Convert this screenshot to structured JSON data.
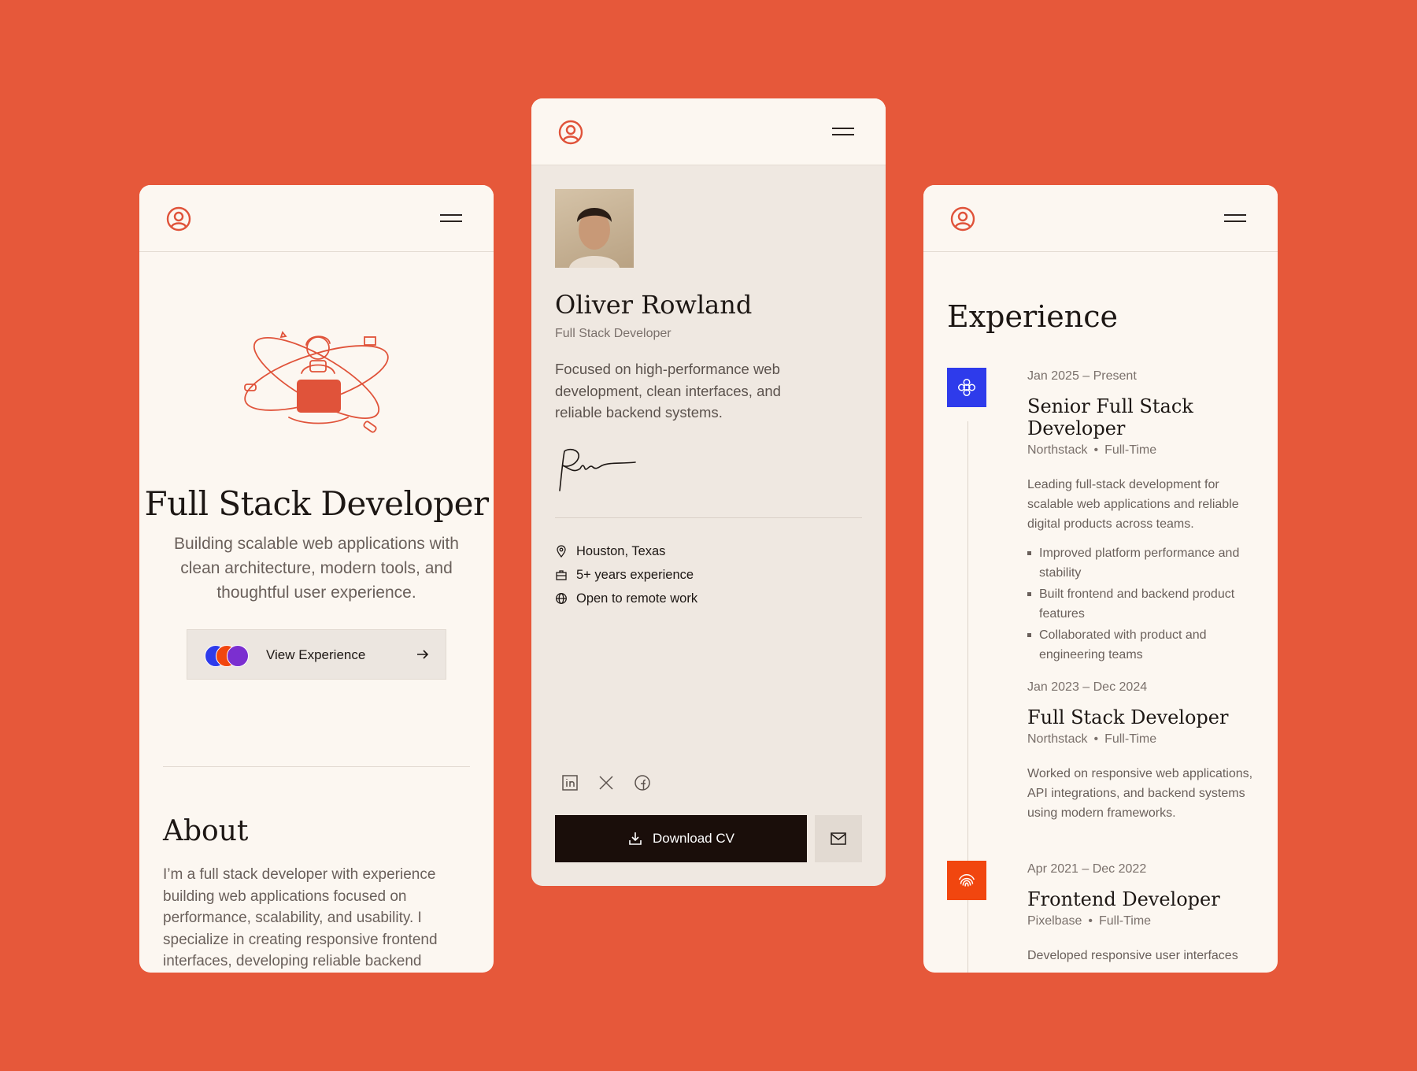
{
  "colors": {
    "background": "#E6583A",
    "card": "#FCF7F1",
    "accent": "#E0533A",
    "dark_button": "#1A0E0A",
    "badge_blue": "#2E3BEB",
    "badge_orange": "#F1460F"
  },
  "left_card": {
    "hero": {
      "title": "Full Stack Developer",
      "subtitle": "Building scalable web applications with clean architecture, modern tools, and thoughtful user experience."
    },
    "view_button": {
      "label": "View Experience",
      "logos": [
        "blue-logo",
        "orange-logo",
        "purple-logo"
      ]
    },
    "about": {
      "title": "About",
      "text": "I’m a full stack developer with experience building web applications focused on performance, scalability, and usability. I specialize in creating responsive frontend interfaces, developing reliable backend"
    }
  },
  "mid_card": {
    "name": "Oliver Rowland",
    "role": "Full Stack Developer",
    "bio": "Focused on high-performance web development, clean interfaces, and reliable backend systems.",
    "info": [
      {
        "icon": "location-pin-icon",
        "text": "Houston, Texas"
      },
      {
        "icon": "briefcase-icon",
        "text": "5+ years experience"
      },
      {
        "icon": "globe-icon",
        "text": "Open to remote work"
      }
    ],
    "socials": [
      "linkedin-icon",
      "x-icon",
      "facebook-icon"
    ],
    "download_label": "Download CV"
  },
  "right_card": {
    "title": "Experience",
    "jobs": [
      {
        "date": "Jan 2025 – Present",
        "title": "Senior Full Stack Developer",
        "company": "Northstack",
        "type": "Full-Time",
        "badge": "blue-flower-logo",
        "description": "Leading full-stack development for scalable web applications and reliable digital products across teams.",
        "bullets": [
          "Improved platform performance and stability",
          "Built frontend and backend product features",
          "Collaborated with product and engineering teams"
        ]
      },
      {
        "date": "Jan 2023 – Dec 2024",
        "title": "Full Stack Developer",
        "company": "Northstack",
        "type": "Full-Time",
        "description": "Worked on responsive web applications, API integrations, and backend systems using modern frameworks."
      },
      {
        "date": "Apr 2021 – Dec 2022",
        "title": "Frontend Developer",
        "company": "Pixelbase",
        "type": "Full-Time",
        "badge": "orange-fingerprint-logo",
        "description": "Developed responsive user interfaces"
      }
    ]
  }
}
